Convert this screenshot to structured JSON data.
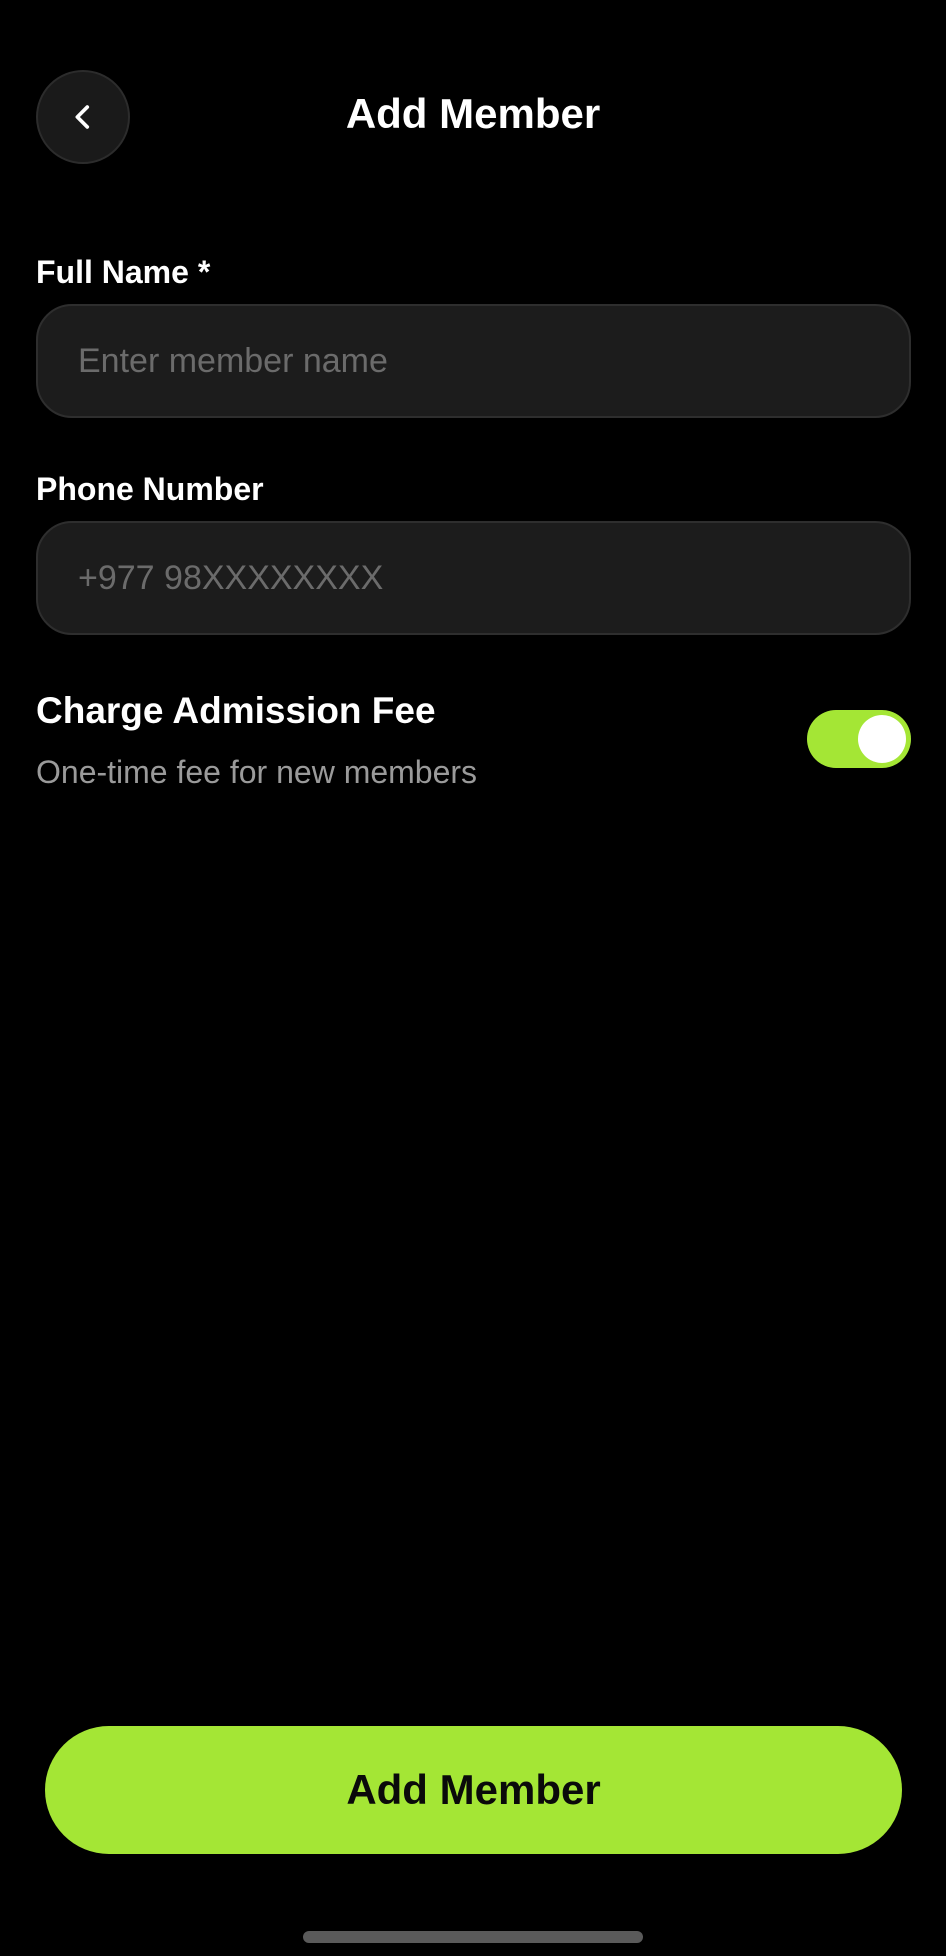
{
  "header": {
    "title": "Add Member",
    "back_icon": "chevron-left-icon"
  },
  "form": {
    "full_name": {
      "label": "Full Name *",
      "value": "",
      "placeholder": "Enter member name"
    },
    "phone": {
      "label": "Phone Number",
      "value": "",
      "placeholder": "+977 98XXXXXXXX"
    },
    "admission_fee": {
      "title": "Charge Admission Fee",
      "subtitle": "One-time fee for new members",
      "enabled": true
    }
  },
  "footer": {
    "submit_label": "Add Member"
  },
  "colors": {
    "accent": "#a4e635",
    "background": "#000000",
    "input_background": "#1c1c1c",
    "muted_text": "#9a9a9a",
    "placeholder_text": "#6b6b6b"
  }
}
